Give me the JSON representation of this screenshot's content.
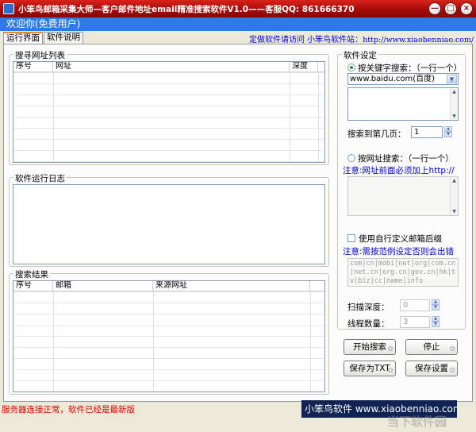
{
  "window": {
    "title": "小笨鸟邮箱采集大师—客户邮件地址email精准搜索软件V1.0——客服QQ: 861666370",
    "min_glyph": "—",
    "max_glyph": "□",
    "close_glyph": "×"
  },
  "welcome": "欢迎你(免费用户)",
  "tabs": [
    "运行界面",
    "软件说明"
  ],
  "site_link": {
    "prefix": "定做软件请访问  小笨鸟软件站：",
    "url": "http://www.xiaobenniao.com/"
  },
  "url_list": {
    "title": "搜寻网址列表",
    "columns": [
      "序号",
      "网址",
      "深度"
    ]
  },
  "log": {
    "title": "软件运行日志"
  },
  "results": {
    "title": "搜索结果",
    "columns": [
      "序号",
      "邮箱",
      "来源网址"
    ]
  },
  "settings": {
    "title": "软件设定",
    "keyword_search_label": "按关键字搜索：（一行一个）",
    "engine_selected": "www.baidu.com(百度)",
    "page_label": "搜索到第几页：",
    "page_value": "1",
    "url_search_label": "按网址搜索：（一行一个）",
    "url_note": "注意:网址前面必须加上http://",
    "custom_suffix_label": "使用自行定义邮箱后缀",
    "suffix_note": "注意:需按范例设定否则会出错",
    "suffix_example": "com|cn|mobi|net|org|com.cn|net.cn|org.cn|gov.cn|hk|tv|biz|cc|name|info",
    "depth_label": "扫描深度：",
    "depth_value": "0",
    "threads_label": "线程数量：",
    "threads_value": "3"
  },
  "buttons": {
    "start": "开始搜索",
    "stop": "停止",
    "save_txt": "保存为TXT",
    "save_settings": "保存设置"
  },
  "status": "服务器连接正常，软件已经是最新版",
  "banner": "小笨鸟软件 www.xiaobenniao.com",
  "watermark": "当下软件园"
}
